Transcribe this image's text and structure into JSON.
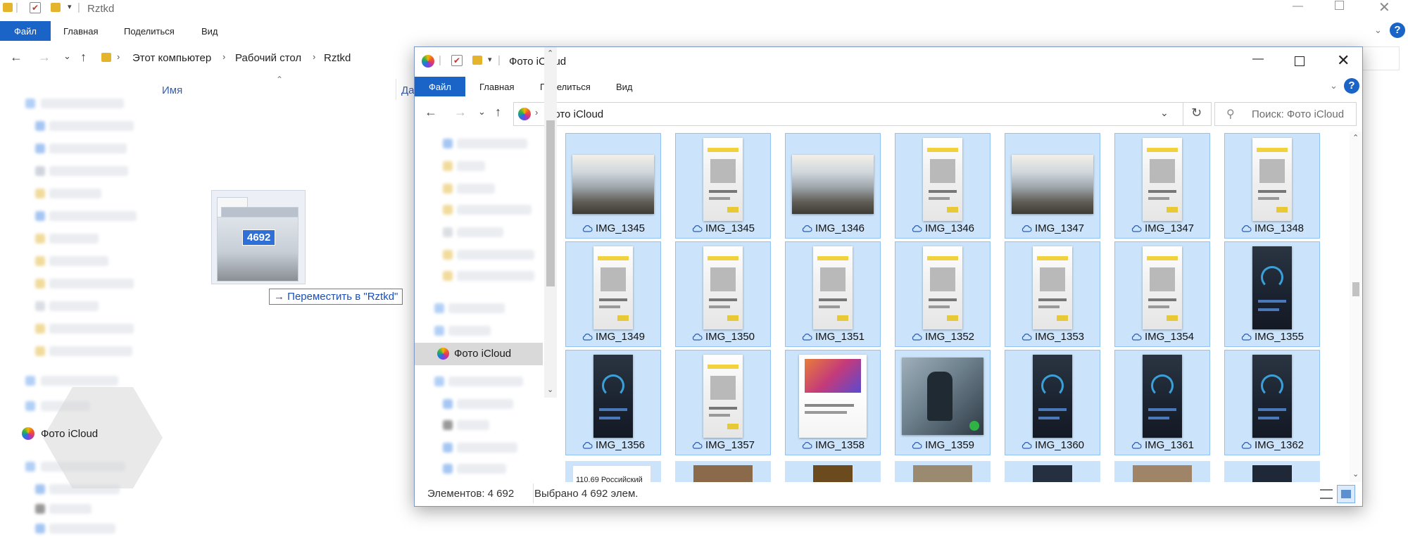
{
  "background_window": {
    "title": "Rztkd",
    "ribbon": {
      "file": "Файл",
      "home": "Главная",
      "share": "Поделиться",
      "view": "Вид"
    },
    "breadcrumb": [
      "Этот компьютер",
      "Рабочий стол",
      "Rztkd"
    ],
    "column_name": "Имя",
    "column_date_partial": "Да",
    "nav_photos": "Фото iCloud"
  },
  "drag": {
    "count": "4692",
    "tooltip": "→ Переместить в \"Rztkd\""
  },
  "window": {
    "title": "Фото iCloud",
    "ribbon": {
      "file": "Файл",
      "home": "Главная",
      "share": "Поделиться",
      "view": "Вид"
    },
    "address": "Фото iCloud",
    "search_placeholder": "Поиск: Фото iCloud",
    "nav_selected": "Фото iCloud",
    "status_count": "Элементов: 4 692",
    "status_selected": "Выбрано 4 692 элем."
  },
  "tiles": [
    {
      "label": "IMG_1345",
      "kind": "landscape"
    },
    {
      "label": "IMG_1345",
      "kind": "phone"
    },
    {
      "label": "IMG_1346",
      "kind": "landscape"
    },
    {
      "label": "IMG_1346",
      "kind": "phone"
    },
    {
      "label": "IMG_1347",
      "kind": "landscape"
    },
    {
      "label": "IMG_1347",
      "kind": "phone"
    },
    {
      "label": "IMG_1348",
      "kind": "phone"
    },
    {
      "label": "IMG_1349",
      "kind": "phone"
    },
    {
      "label": "IMG_1350",
      "kind": "phone"
    },
    {
      "label": "IMG_1351",
      "kind": "phone"
    },
    {
      "label": "IMG_1352",
      "kind": "phone"
    },
    {
      "label": "IMG_1353",
      "kind": "phone"
    },
    {
      "label": "IMG_1354",
      "kind": "phone"
    },
    {
      "label": "IMG_1355",
      "kind": "phone-dark"
    },
    {
      "label": "IMG_1356",
      "kind": "phone-dark"
    },
    {
      "label": "IMG_1357",
      "kind": "phone"
    },
    {
      "label": "IMG_1358",
      "kind": "laptop"
    },
    {
      "label": "IMG_1359",
      "kind": "poster"
    },
    {
      "label": "IMG_1360",
      "kind": "phone-dark"
    },
    {
      "label": "IMG_1361",
      "kind": "phone-dark"
    },
    {
      "label": "IMG_1362",
      "kind": "phone-dark"
    }
  ],
  "partial_row_text": "110.69 Российский",
  "colors": {
    "accent": "#1a63c7",
    "selection": "#cce4fb",
    "selection_border": "#91c2f5",
    "help": "#1a63c7"
  }
}
